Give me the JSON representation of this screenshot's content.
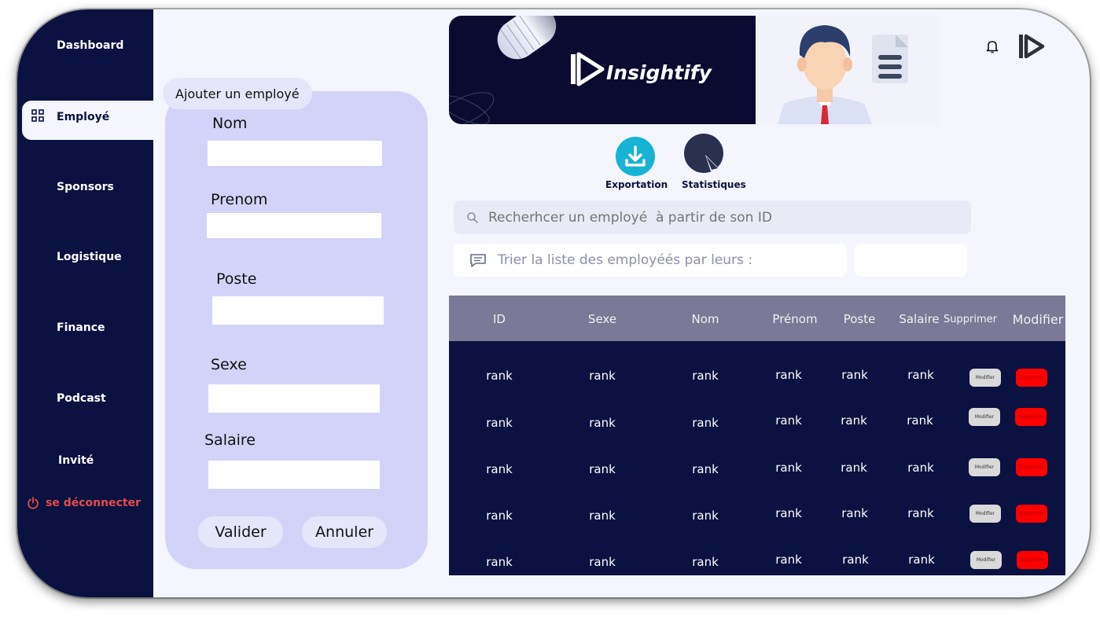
{
  "sidebar": {
    "items": [
      {
        "label": "Dashboard"
      },
      {
        "label": "Employé"
      },
      {
        "label": "Sponsors"
      },
      {
        "label": "Logistique"
      },
      {
        "label": "Finance"
      },
      {
        "label": "Podcast"
      },
      {
        "label": "Invité"
      }
    ],
    "logout": "se déconnecter"
  },
  "form": {
    "title": "Ajouter un employé",
    "fields": [
      {
        "label": "Nom",
        "value": ""
      },
      {
        "label": "Prenom",
        "value": ""
      },
      {
        "label": "Poste",
        "value": ""
      },
      {
        "label": "Sexe",
        "value": ""
      },
      {
        "label": "Salaire",
        "value": ""
      }
    ],
    "submit": "Valider",
    "cancel": "Annuler"
  },
  "banner": {
    "brand": "Insightify"
  },
  "actions": {
    "export": "Exportation",
    "stats": "Statistiques"
  },
  "search": {
    "placeholder": "Recherhcer un employé  à partir de son ID"
  },
  "sort": {
    "label": "Trier la liste des employéés par leurs :"
  },
  "table": {
    "columns": [
      "ID",
      "Sexe",
      "Nom",
      "Prénom",
      "Poste",
      "Salaire",
      "Supprimer",
      "Modifier"
    ],
    "rows": [
      [
        "rank",
        "rank",
        "rank",
        "rank",
        "rank",
        "rank"
      ],
      [
        "rank",
        "rank",
        "rank",
        "rank",
        "rank",
        "rank"
      ],
      [
        "rank",
        "rank",
        "rank",
        "rank",
        "rank",
        "rank"
      ],
      [
        "rank",
        "rank",
        "rank",
        "rank",
        "rank",
        "rank"
      ],
      [
        "rank",
        "rank",
        "rank",
        "rank",
        "rank",
        "rank"
      ]
    ],
    "modify_label": "Modifier",
    "delete_label": "Supprimer"
  },
  "colors": {
    "sidebar": "#0b1140",
    "form": "#d3d3fa",
    "table_header": "#7b7997",
    "delete": "#ff0000",
    "export": "#17b3d4",
    "stats": "#2a3050",
    "logout": "#e24b4b"
  }
}
